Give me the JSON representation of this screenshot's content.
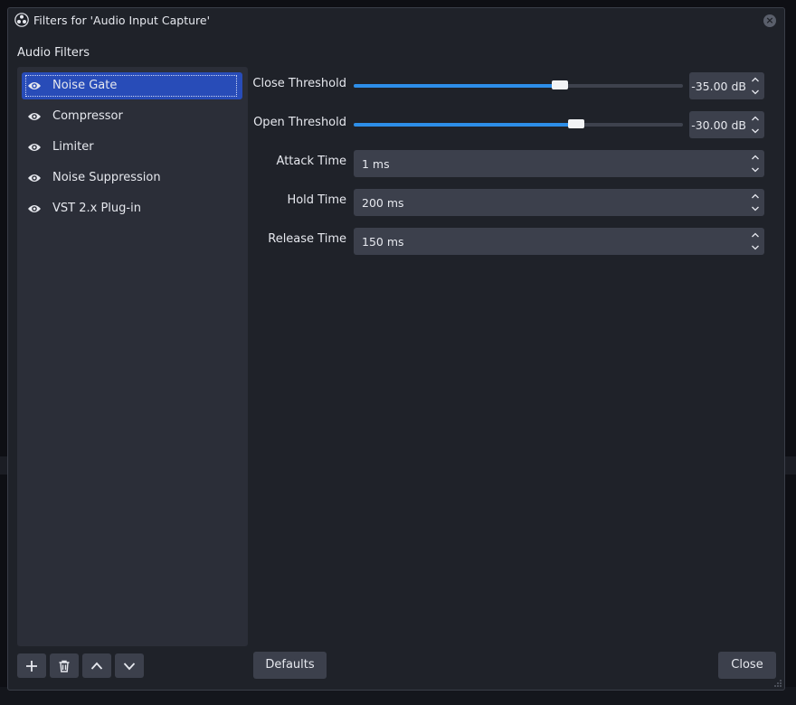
{
  "window": {
    "title": "Filters for 'Audio Input Capture'"
  },
  "left_panel": {
    "label": "Audio Filters",
    "filters": [
      {
        "label": "Noise Gate",
        "selected": true
      },
      {
        "label": "Compressor",
        "selected": false
      },
      {
        "label": "Limiter",
        "selected": false
      },
      {
        "label": "Noise Suppression",
        "selected": false
      },
      {
        "label": "VST 2.x Plug-in",
        "selected": false
      }
    ],
    "buttons": {
      "add": "add-icon",
      "remove": "trash-icon",
      "move_up": "chevron-up-icon",
      "move_down": "chevron-down-icon"
    }
  },
  "properties": {
    "close_threshold": {
      "label": "Close Threshold",
      "value": "-35.00 dB",
      "slider_fraction": 0.627
    },
    "open_threshold": {
      "label": "Open Threshold",
      "value": "-30.00 dB",
      "slider_fraction": 0.676
    },
    "attack_time": {
      "label": "Attack Time",
      "value": "1 ms"
    },
    "hold_time": {
      "label": "Hold Time",
      "value": "200 ms"
    },
    "release_time": {
      "label": "Release Time",
      "value": "150 ms"
    }
  },
  "footer": {
    "defaults_label": "Defaults",
    "close_label": "Close"
  },
  "colors": {
    "accent": "#2d8ee8",
    "selection": "#284cb8",
    "background": "#1f2229",
    "panel": "#2b2e38",
    "control": "#3c404c"
  }
}
